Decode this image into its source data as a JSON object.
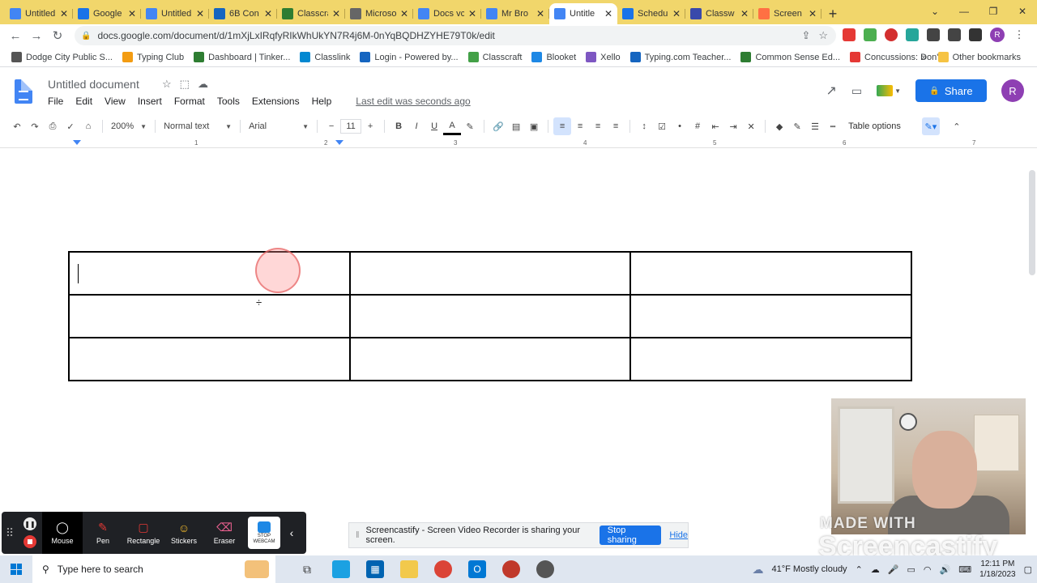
{
  "browser": {
    "tabs": [
      {
        "label": "Untitled",
        "color": "#4285f4"
      },
      {
        "label": "Google",
        "color": "#1a73e8"
      },
      {
        "label": "Untitled",
        "color": "#4285f4"
      },
      {
        "label": "6B Con",
        "color": "#1565c0"
      },
      {
        "label": "Classcra",
        "color": "#2e7d32"
      },
      {
        "label": "Microso",
        "color": "#666666"
      },
      {
        "label": "Docs vc",
        "color": "#4285f4"
      },
      {
        "label": "Mr Bro",
        "color": "#4285f4"
      },
      {
        "label": "Untitle",
        "color": "#4285f4"
      },
      {
        "label": "Schedu",
        "color": "#1a73e8"
      },
      {
        "label": "Classw",
        "color": "#3949ab"
      },
      {
        "label": "Screen",
        "color": "#ff7043"
      }
    ],
    "url": "docs.google.com/document/d/1mXjLxIRqfyRIkWhUkYN7R4j6M-0nYqBQDHZYHE79T0k/edit"
  },
  "bookmarks": [
    {
      "label": "Dodge City Public S...",
      "color": "#555555"
    },
    {
      "label": "Typing Club",
      "color": "#f39c12"
    },
    {
      "label": "Dashboard | Tinker...",
      "color": "#2e7d32"
    },
    {
      "label": "Classlink",
      "color": "#0288d1"
    },
    {
      "label": "Login - Powered by...",
      "color": "#1565c0"
    },
    {
      "label": "Classcraft",
      "color": "#43a047"
    },
    {
      "label": "Blooket",
      "color": "#1e88e5"
    },
    {
      "label": "Xello",
      "color": "#7e57c2"
    },
    {
      "label": "Typing.com Teacher...",
      "color": "#1565c0"
    },
    {
      "label": "Common Sense Ed...",
      "color": "#2e7d32"
    },
    {
      "label": "Concussions: Don't...",
      "color": "#e53935"
    }
  ],
  "bookmarks_more": "»",
  "bookmarks_other": "Other bookmarks",
  "docs": {
    "title": "Untitled document",
    "menu": [
      "File",
      "Edit",
      "View",
      "Insert",
      "Format",
      "Tools",
      "Extensions",
      "Help"
    ],
    "last_edit": "Last edit was seconds ago",
    "share_label": "Share",
    "avatar_initial": "R",
    "toolbar": {
      "zoom": "200%",
      "style": "Normal text",
      "font": "Arial",
      "font_size": "11",
      "table_options": "Table options"
    },
    "ruler_numbers": [
      "1",
      "2",
      "3",
      "4",
      "5",
      "6",
      "7"
    ]
  },
  "screencastify": {
    "tools": [
      {
        "label": "Mouse",
        "icon": "mouse-icon"
      },
      {
        "label": "Pen",
        "icon": "pen-icon"
      },
      {
        "label": "Rectangle",
        "icon": "rectangle-icon"
      },
      {
        "label": "Stickers",
        "icon": "stickers-icon"
      },
      {
        "label": "Eraser",
        "icon": "eraser-icon"
      }
    ],
    "webcam_label": "STOP WEBCAM",
    "sharing_text": "Screencastify - Screen Video Recorder is sharing your screen.",
    "stop_sharing": "Stop sharing",
    "hide": "Hide",
    "watermark_top": "MADE WITH",
    "watermark_brand": "Screencastify"
  },
  "taskbar": {
    "search_placeholder": "Type here to search",
    "weather": "41°F Mostly cloudy",
    "time": "12:11 PM",
    "date": "1/18/2023"
  }
}
